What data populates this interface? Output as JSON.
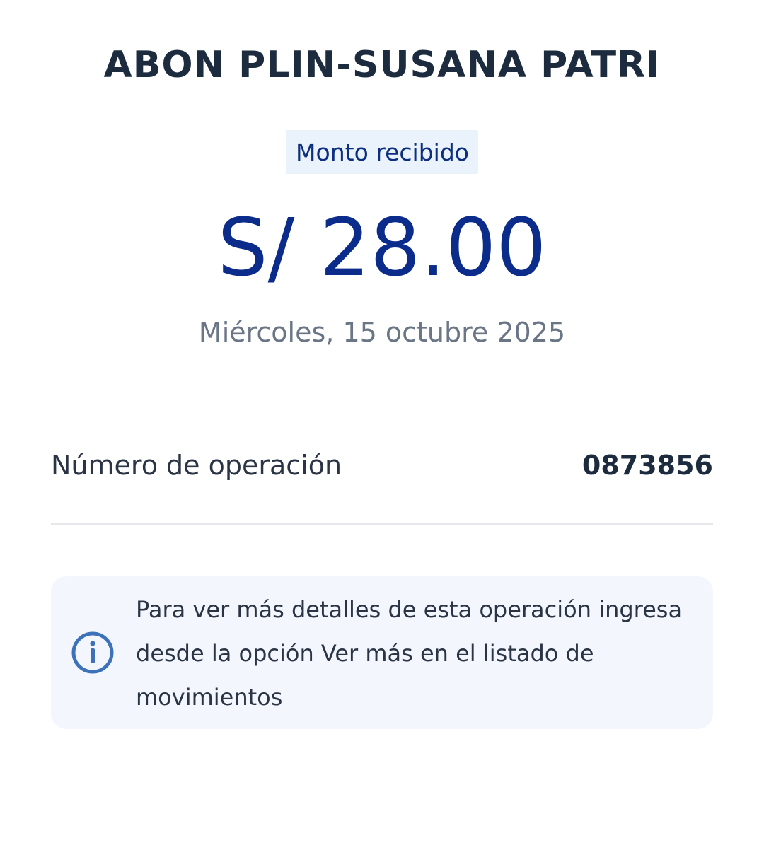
{
  "header": {
    "title": "ABON PLIN-SUSANA PATRI",
    "badge_label": "Monto recibido"
  },
  "amount": {
    "display": "S/ 28.00",
    "color": "#0b2c8a"
  },
  "date": "Miércoles, 15 octubre 2025",
  "details": {
    "operation_label": "Número de operación",
    "operation_value": "0873856"
  },
  "info": {
    "icon": "info-icon",
    "message": "Para ver más detalles de esta operación ingresa desde la opción Ver más en el listado de movimientos"
  },
  "colors": {
    "accent": "#0b2c8a",
    "badge_bg": "#eaf3fc",
    "info_bg": "#f3f7fd",
    "icon": "#3d72b8"
  }
}
